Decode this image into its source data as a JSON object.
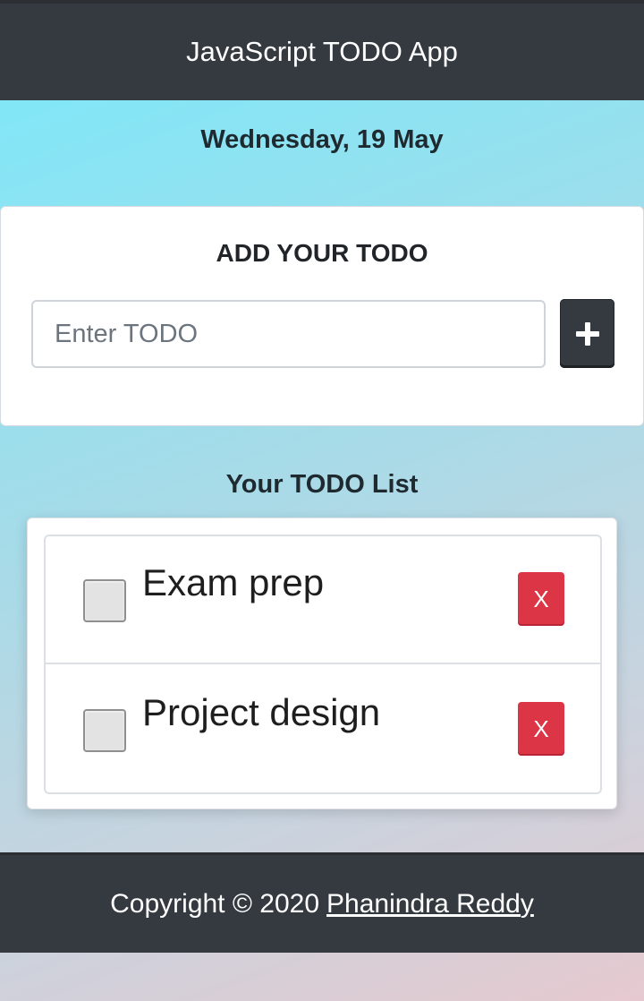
{
  "header": {
    "title": "JavaScript TODO App"
  },
  "date": "Wednesday, 19 May",
  "add_section": {
    "heading": "ADD YOUR TODO",
    "input_placeholder": "Enter TODO",
    "input_value": "",
    "add_icon": "plus-icon"
  },
  "list_section": {
    "heading": "Your TODO List",
    "items": [
      {
        "text": "Exam prep",
        "checked": false,
        "delete_label": "X"
      },
      {
        "text": "Project design",
        "checked": false,
        "delete_label": "X"
      }
    ]
  },
  "footer": {
    "copyright": "Copyright © 2020",
    "author_link": "Phanindra Reddy"
  },
  "colors": {
    "dark": "#343a40",
    "danger": "#dc3545",
    "gradient_start": "#79e9fa",
    "gradient_end": "#e6c9cf"
  }
}
